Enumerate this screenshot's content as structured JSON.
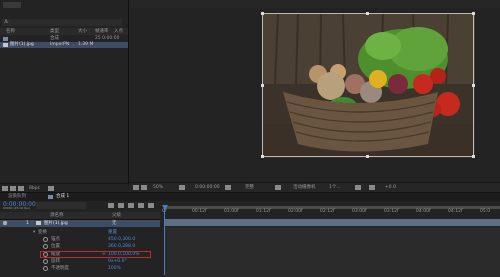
{
  "project_panel": {
    "search_value": "ル",
    "columns": {
      "name": "名称",
      "type": "类型",
      "size": "大小",
      "frame_rate": "帧速率",
      "in_point": "入点"
    },
    "items": [
      {
        "name": "",
        "type": "合成",
        "size": "",
        "extra": "25 0:00:00"
      },
      {
        "name": "图片(1).jpg",
        "type": "ImporPN",
        "size": "1.39 M",
        "extra": ""
      }
    ],
    "bpc": "8bpc"
  },
  "viewer": {
    "zoom": "50%",
    "timecode": "0:00:00:00",
    "quality": "完整",
    "camera": "活动摄像机",
    "views": "1个...",
    "offset": "+0.0"
  },
  "timeline": {
    "tabs": [
      "渲染队列",
      "合成 1"
    ],
    "current_time": "0:00:00:00",
    "frame_info": "00000 (25.00 fps)",
    "header": {
      "source_name": "源名称",
      "parent": "父级"
    },
    "layer": {
      "index": "1",
      "name": "图片(1).jpg",
      "parent": "无"
    },
    "transform_label": "变换",
    "transform_reset": "重置",
    "properties": [
      {
        "name": "锚点",
        "value": "450.0,300.0"
      },
      {
        "name": "位置",
        "value": "360.0,288.0"
      },
      {
        "name": "缩放",
        "value": "100.0,100.0%"
      },
      {
        "name": "旋转",
        "value": "0x+0.0°"
      },
      {
        "name": "不透明度",
        "value": "100%"
      }
    ],
    "ruler_labels": [
      "0f",
      "00:12f",
      "01:00f",
      "01:12f",
      "02:00f",
      "02:12f",
      "03:00f",
      "03:12f",
      "04:00f",
      "04:12f",
      "05:0"
    ]
  }
}
